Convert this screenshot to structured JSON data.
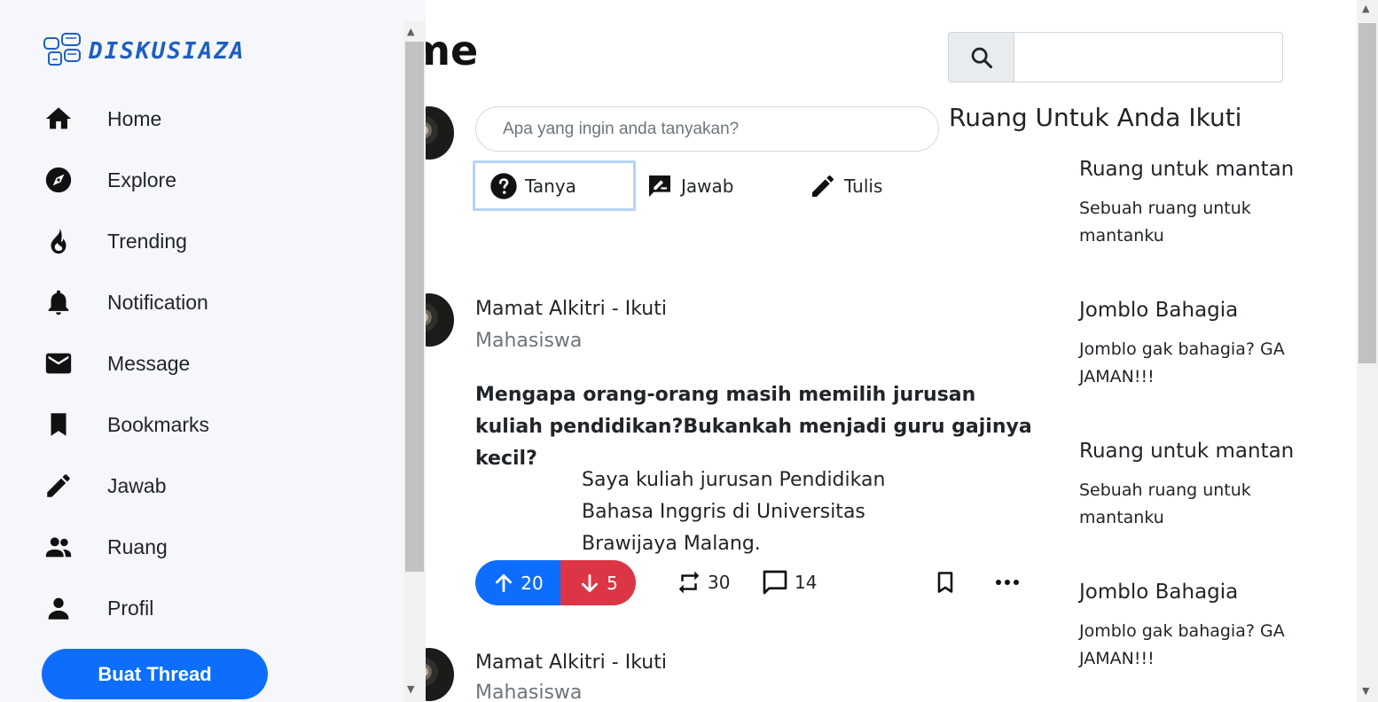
{
  "app": {
    "logo_text": "DISKUSIAZA"
  },
  "sidebar": {
    "items": [
      {
        "label": "Home",
        "icon": "home-icon"
      },
      {
        "label": "Explore",
        "icon": "compass-icon"
      },
      {
        "label": "Trending",
        "icon": "flame-icon"
      },
      {
        "label": "Notification",
        "icon": "bell-icon"
      },
      {
        "label": "Message",
        "icon": "mail-icon"
      },
      {
        "label": "Bookmarks",
        "icon": "bookmark-icon"
      },
      {
        "label": "Jawab",
        "icon": "pencil-icon"
      },
      {
        "label": "Ruang",
        "icon": "people-icon"
      },
      {
        "label": "Profil",
        "icon": "person-icon"
      }
    ],
    "cta_label": "Buat Thread"
  },
  "page": {
    "title": "Home"
  },
  "composer": {
    "placeholder": "Apa yang ingin anda tanyakan?",
    "actions": [
      {
        "label": "Tanya",
        "icon": "question-circle-icon",
        "active": true
      },
      {
        "label": "Jawab",
        "icon": "answer-icon"
      },
      {
        "label": "Tulis",
        "icon": "pencil-icon"
      }
    ]
  },
  "posts": [
    {
      "author": "Mamat Alkitri - Ikuti",
      "role": "Mahasiswa",
      "question": "Mengapa orang-orang masih memilih jurusan kuliah pendidikan?Bukankah menjadi guru gajinya kecil?",
      "answer": "Saya kuliah jurusan Pendidikan Bahasa Inggris di Universitas Brawijaya Malang.",
      "upvotes": "20",
      "downvotes": "5",
      "reposts": "30",
      "comments": "14"
    },
    {
      "author": "Mamat Alkitri - Ikuti",
      "role": "Mahasiswa"
    }
  ],
  "search": {
    "placeholder": ""
  },
  "rooms": {
    "title": "Ruang Untuk Anda Ikuti",
    "items": [
      {
        "name": "Ruang untuk mantan",
        "desc": "Sebuah ruang untuk mantanku"
      },
      {
        "name": "Jomblo Bahagia",
        "desc": "Jomblo gak bahagia? GA JAMAN!!!"
      },
      {
        "name": "Ruang untuk mantan",
        "desc": "Sebuah ruang untuk mantanku"
      },
      {
        "name": "Jomblo Bahagia",
        "desc": "Jomblo gak bahagia? GA JAMAN!!!"
      }
    ]
  },
  "colors": {
    "primary": "#0d6efd",
    "danger": "#dc3545",
    "sidebar_bg": "#f5f7fb",
    "logo": "#1f5fbf"
  }
}
